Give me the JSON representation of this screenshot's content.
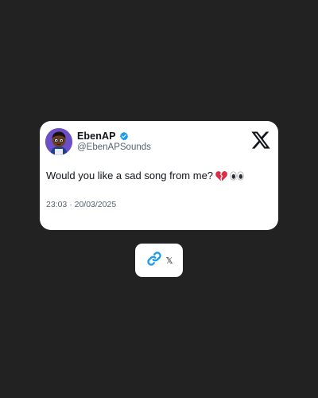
{
  "tweet": {
    "display_name": "EbenAP",
    "handle": "@EbenAPSounds",
    "text": "Would you like a sad song from me?",
    "emojis": [
      "broken-heart-icon",
      "eyes-icon"
    ],
    "timestamp": "23:03 · 20/03/2025",
    "verified": true,
    "verified_color": "#1d9bf0"
  },
  "share": {
    "link_icon": "link-icon",
    "platform_label": "𝕏",
    "link_color": "#1d9bf0"
  },
  "colors": {
    "background": "#222222",
    "card": "#ffffff",
    "text_primary": "#0f1419",
    "text_secondary": "#536471",
    "avatar_bg": "#6a4fc7"
  }
}
